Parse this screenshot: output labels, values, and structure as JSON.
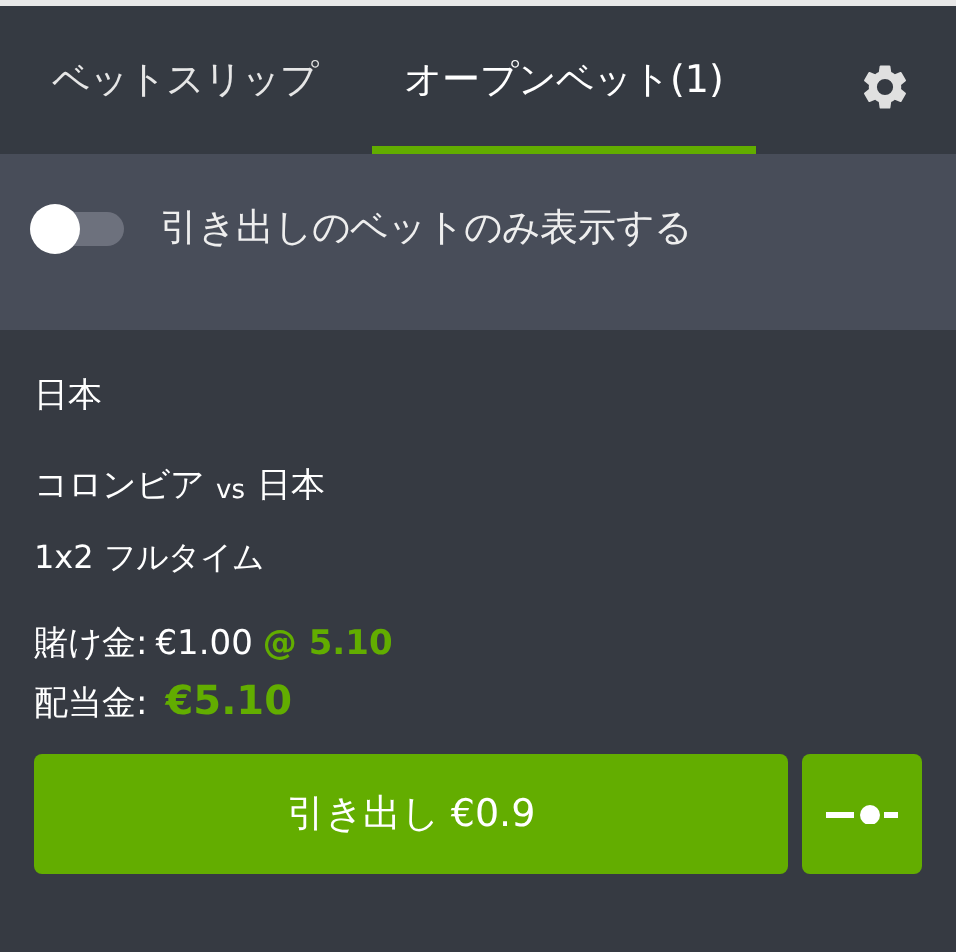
{
  "tabs": [
    {
      "label": "ベットスリップ",
      "selected": false
    },
    {
      "label": "オープンベット(1)",
      "selected": true
    }
  ],
  "filter": {
    "label": "引き出しのベットのみ表示する",
    "on": false
  },
  "bet": {
    "selection": "日本",
    "home": "コロンビア",
    "vs": "vs",
    "away": "日本",
    "market": "1x2 フルタイム",
    "stake_label": "賭け金:",
    "stake": "€1.00",
    "odds": "@ 5.10",
    "payout_label": "配当金:",
    "payout": "€5.10",
    "cashout_button": "引き出し €0.9"
  }
}
